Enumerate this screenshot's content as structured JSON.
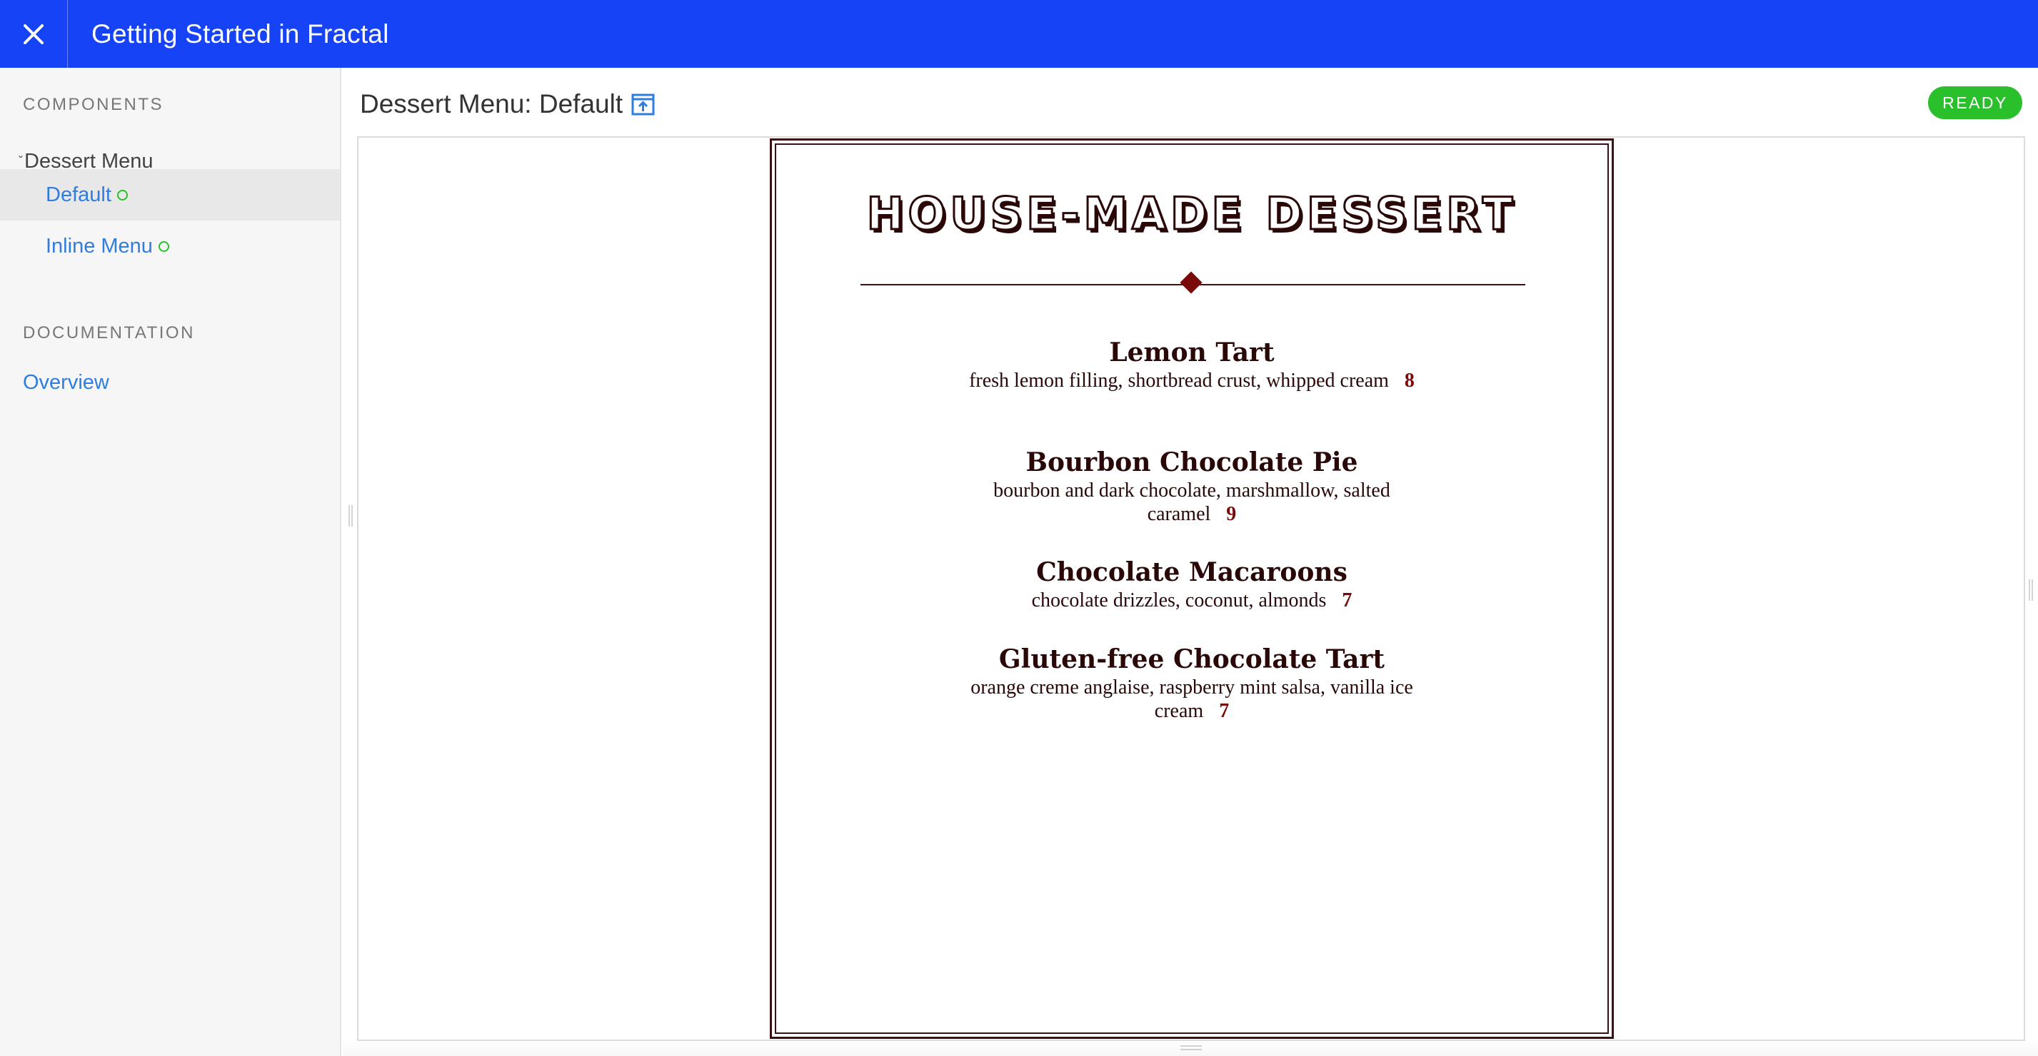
{
  "app": {
    "title": "Getting Started in Fractal"
  },
  "sidebar": {
    "components_heading": "COMPONENTS",
    "component_group": "Dessert Menu",
    "items": [
      {
        "label": "Default",
        "active": true,
        "status_color": "#29c02c"
      },
      {
        "label": "Inline Menu",
        "active": false,
        "status_color": "#29c02c"
      }
    ],
    "documentation_heading": "DOCUMENTATION",
    "docs": [
      {
        "label": "Overview"
      }
    ]
  },
  "main": {
    "title": "Dessert Menu: Default",
    "status_badge": "READY",
    "status_color": "#29c02c"
  },
  "preview": {
    "menu_title": "HOUSE-MADE DESSERT",
    "dishes": [
      {
        "name": "Lemon Tart",
        "description": "fresh lemon filling, shortbread crust, whipped cream",
        "price": "8"
      },
      {
        "name": "Bourbon Chocolate Pie",
        "description": "bourbon and dark chocolate, marshmallow, salted caramel",
        "price": "9"
      },
      {
        "name": "Chocolate Macaroons",
        "description": "chocolate drizzles, coconut, almonds",
        "price": "7"
      },
      {
        "name": "Gluten-free Chocolate Tart",
        "description": "orange creme anglaise, raspberry mint salsa, vanilla ice cream",
        "price": "7"
      }
    ]
  },
  "colors": {
    "topbar": "#1543f5",
    "link": "#2f7de1",
    "menu_ink": "#2a0808",
    "price": "#7a0a0a"
  }
}
